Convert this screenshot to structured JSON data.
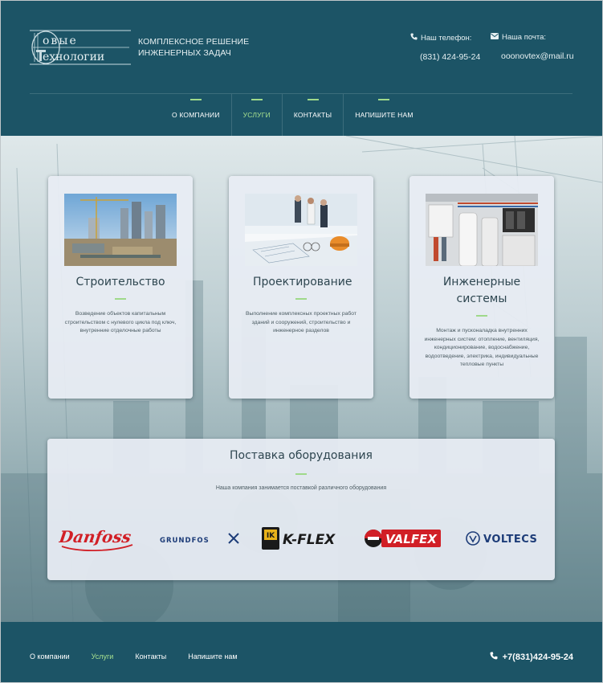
{
  "header": {
    "logo_text": "НОВЫЕ ТЕХНОЛОГИИ",
    "logo_top": "овые",
    "logo_bottom": "ехнологии",
    "tagline_line1": "КОМПЛЕКСНОЕ РЕШЕНИЕ",
    "tagline_line2": "ИНЖЕНЕРНЫХ ЗАДАЧ",
    "phone_label": "Наш телефон:",
    "phone_value": "(831) 424-95-24",
    "email_label": "Наша почта:",
    "email_value": "ooonovtex@mail.ru"
  },
  "nav": {
    "items": [
      {
        "label": "О КОМПАНИИ",
        "active": false
      },
      {
        "label": "УСЛУГИ",
        "active": true
      },
      {
        "label": "КОНТАКТЫ",
        "active": false
      },
      {
        "label": "НАПИШИТЕ НАМ",
        "active": false
      }
    ]
  },
  "services": [
    {
      "title": "Строительство",
      "text": "Возведение объектов капитальным строительством с нулевого цикла под ключ, внутренние отделочные работы",
      "image": "construction-site-photo"
    },
    {
      "title": "Проектирование",
      "text": "Выполнение комплексных проектных работ зданий и сооружений, строительство и инженерное разделов",
      "image": "engineers-at-blueprints-photo"
    },
    {
      "title": "Инженерные системы",
      "text": "Монтаж и пусконаладка внутренних инженерных систем: отопление, вентиляция, кондиционирование, водоснабжение, водоотведение, электрика, индивидуальные тепловые пункты",
      "image": "boiler-room-photo"
    }
  ],
  "supply": {
    "title": "Поставка оборудования",
    "text": "Наша компания занимается поставкой различного оборудования",
    "brands": [
      "Danfoss",
      "GRUNDFOS",
      "K-FLEX",
      "VALFEX",
      "VOLTECS"
    ]
  },
  "footer": {
    "links": [
      {
        "label": "О компании",
        "active": false
      },
      {
        "label": "Услуги",
        "active": true
      },
      {
        "label": "Контакты",
        "active": false
      },
      {
        "label": "Напишите нам",
        "active": false
      }
    ],
    "phone": "+7(831)424-95-24"
  },
  "colors": {
    "header_bg": "#1c5466",
    "accent_green": "#9fd98a",
    "card_bg": "#e8edf4",
    "heading_text": "#2e4650"
  }
}
